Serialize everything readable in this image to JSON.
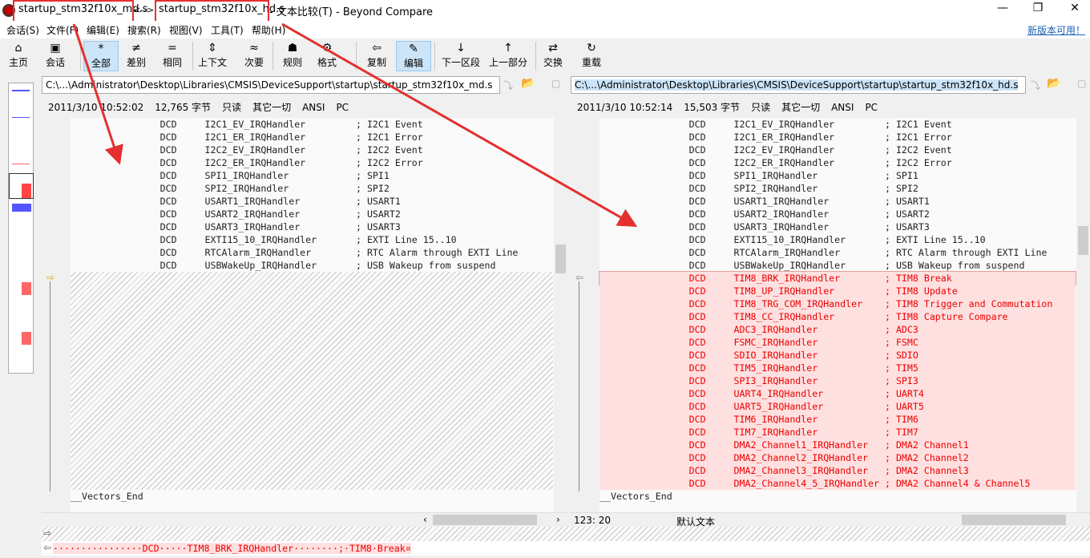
{
  "title": {
    "left_file": "startup_stm32f10x_md.s",
    "sep": "<-->",
    "right_file": "startup_stm32f10x_hd.s",
    "suffix": "- 文本比较(T) - Beyond Compare"
  },
  "window": {
    "minimize": "—",
    "maximize": "❐",
    "close": "✕"
  },
  "menu": [
    "会话(S)",
    "文件(F)",
    "编辑(E)",
    "搜索(R)",
    "视图(V)",
    "工具(T)",
    "帮助(H)"
  ],
  "new_version": "新版本可用！",
  "toolbar": [
    {
      "label": "主页",
      "icon": "⌂"
    },
    {
      "label": "会话",
      "icon": "▣"
    },
    {
      "label": "全部",
      "icon": "*"
    },
    {
      "label": "差别",
      "icon": "≠"
    },
    {
      "label": "相同",
      "icon": "="
    },
    {
      "label": "上下文",
      "icon": "⇕"
    },
    {
      "label": "次要",
      "icon": "≈"
    },
    {
      "label": "规则",
      "icon": "☗"
    },
    {
      "label": "格式",
      "icon": "⚙"
    },
    {
      "label": "复制",
      "icon": "⇦"
    },
    {
      "label": "编辑",
      "icon": "✎"
    },
    {
      "label": "下一区段",
      "icon": "↓"
    },
    {
      "label": "上一部分",
      "icon": "↑"
    },
    {
      "label": "交换",
      "icon": "⇄"
    },
    {
      "label": "重载",
      "icon": "↻"
    }
  ],
  "left": {
    "path": "C:\\...\\Administrator\\Desktop\\Libraries\\CMSIS\\DeviceSupport\\startup\\startup_stm32f10x_md.s",
    "date": "2011/3/10 10:52:02",
    "size": "12,765 字节",
    "readonly": "只读",
    "filter": "其它一切",
    "encoding": "ANSI",
    "eol": "PC"
  },
  "right": {
    "path": "C:\\...\\Administrator\\Desktop\\Libraries\\CMSIS\\DeviceSupport\\startup\\startup_stm32f10x_hd.s",
    "date": "2011/3/10 10:52:14",
    "size": "15,503 字节",
    "readonly": "只读",
    "filter": "其它一切",
    "encoding": "ANSI",
    "eol": "PC"
  },
  "common_lines": [
    [
      "I2C1_EV_IRQHandler",
      "I2C1 Event"
    ],
    [
      "I2C1_ER_IRQHandler",
      "I2C1 Error"
    ],
    [
      "I2C2_EV_IRQHandler",
      "I2C2 Event"
    ],
    [
      "I2C2_ER_IRQHandler",
      "I2C2 Error"
    ],
    [
      "SPI1_IRQHandler",
      "SPI1"
    ],
    [
      "SPI2_IRQHandler",
      "SPI2"
    ],
    [
      "USART1_IRQHandler",
      "USART1"
    ],
    [
      "USART2_IRQHandler",
      "USART2"
    ],
    [
      "USART3_IRQHandler",
      "USART3"
    ],
    [
      "EXTI15_10_IRQHandler",
      "EXTI Line 15..10"
    ],
    [
      "RTCAlarm_IRQHandler",
      "RTC Alarm through EXTI Line"
    ],
    [
      "USBWakeUp_IRQHandler",
      "USB Wakeup from suspend"
    ]
  ],
  "diff_lines": [
    [
      "TIM8_BRK_IRQHandler",
      "TIM8 Break"
    ],
    [
      "TIM8_UP_IRQHandler",
      "TIM8 Update"
    ],
    [
      "TIM8_TRG_COM_IRQHandler",
      "TIM8 Trigger and Commutation"
    ],
    [
      "TIM8_CC_IRQHandler",
      "TIM8 Capture Compare"
    ],
    [
      "ADC3_IRQHandler",
      "ADC3"
    ],
    [
      "FSMC_IRQHandler",
      "FSMC"
    ],
    [
      "SDIO_IRQHandler",
      "SDIO"
    ],
    [
      "TIM5_IRQHandler",
      "TIM5"
    ],
    [
      "SPI3_IRQHandler",
      "SPI3"
    ],
    [
      "UART4_IRQHandler",
      "UART4"
    ],
    [
      "UART5_IRQHandler",
      "UART5"
    ],
    [
      "TIM6_IRQHandler",
      "TIM6"
    ],
    [
      "TIM7_IRQHandler",
      "TIM7"
    ],
    [
      "DMA2_Channel1_IRQHandler",
      "DMA2 Channel1"
    ],
    [
      "DMA2_Channel2_IRQHandler",
      "DMA2 Channel2"
    ],
    [
      "DMA2_Channel3_IRQHandler",
      "DMA2 Channel3"
    ],
    [
      "DMA2_Channel4_5_IRQHandler",
      "DMA2 Channel4 & Channel5"
    ]
  ],
  "directive": "DCD",
  "end_label": "__Vectors_End",
  "status": {
    "position": "123: 20",
    "mode": "默认文本"
  },
  "detail_line": "················DCD·····TIM8_BRK_IRQHandler········;·TIM8·Break¤",
  "colors": {
    "diff_bg": "#ffe0e0",
    "diff_text": "#e00000",
    "accent": "#cce4f7"
  }
}
